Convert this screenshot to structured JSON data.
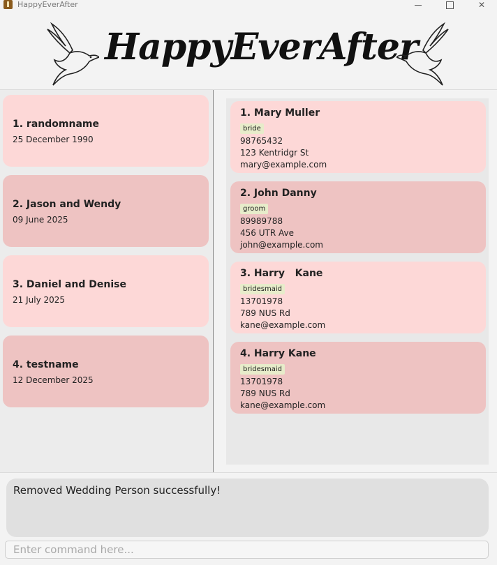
{
  "window": {
    "title": "HappyEverAfter"
  },
  "banner": {
    "title": "HappyEverAfter",
    "icons": [
      "dove-icon",
      "dove-icon"
    ]
  },
  "weddings": [
    {
      "title": "1. randomname",
      "date": "25 December 1990",
      "color": "#fdd8d7"
    },
    {
      "title": "2. Jason and Wendy",
      "date": "09 June 2025",
      "color": "#eec3c2"
    },
    {
      "title": "3. Daniel and Denise",
      "date": "21 July 2025",
      "color": "#fdd8d7"
    },
    {
      "title": "4. testname",
      "date": "12 December 2025",
      "color": "#eec3c2"
    }
  ],
  "persons": [
    {
      "name": "1. Mary Muller",
      "tag": "bride",
      "phone": "98765432",
      "address": "123 Kentridgr St",
      "email": "mary@example.com"
    },
    {
      "name": "2. John Danny",
      "tag": "groom",
      "phone": "89989788",
      "address": "456 UTR Ave",
      "email": "john@example.com"
    },
    {
      "name": "3. Harry   Kane",
      "tag": "bridesmaid",
      "phone": "13701978",
      "address": "789 NUS Rd",
      "email": "kane@example.com"
    },
    {
      "name": "4. Harry Kane",
      "tag": "bridesmaid",
      "phone": "13701978",
      "address": "789 NUS Rd",
      "email": "kane@example.com"
    }
  ],
  "result": {
    "message": "Removed Wedding Person successfully!"
  },
  "command": {
    "value": "",
    "placeholder": "Enter command here..."
  },
  "colors": {
    "card_light": "#fdd8d7",
    "card_dark": "#eec3c2",
    "tag_bg": "#e7ecca"
  }
}
